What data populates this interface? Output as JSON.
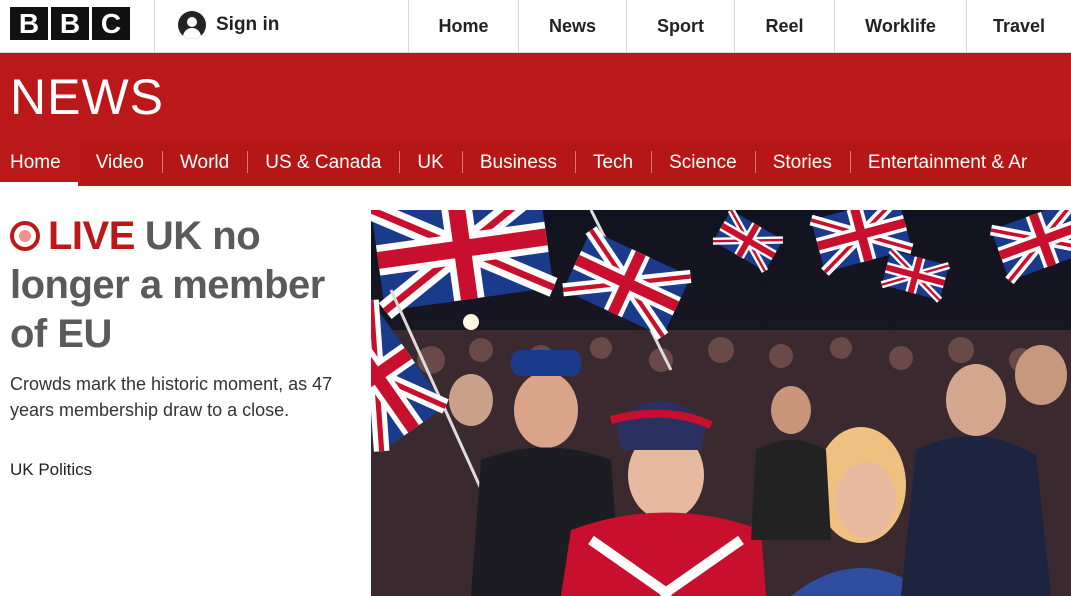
{
  "brand": {
    "letters": [
      "B",
      "B",
      "C"
    ]
  },
  "account": {
    "signin_label": "Sign in"
  },
  "top_nav": [
    "Home",
    "News",
    "Sport",
    "Reel",
    "Worklife",
    "Travel"
  ],
  "section": {
    "title": "NEWS"
  },
  "sub_nav": [
    "Home",
    "Video",
    "World",
    "US & Canada",
    "UK",
    "Business",
    "Tech",
    "Science",
    "Stories",
    "Entertainment & Ar"
  ],
  "article": {
    "live_label": "LIVE",
    "headline": "UK no longer a member of EU",
    "summary": "Crowds mark the historic moment, as 47 years membership draw to a close.",
    "tag": "UK Politics"
  },
  "colors": {
    "brand_red": "#bb1919",
    "live_red": "#bb1919",
    "black": "#111111"
  },
  "icons": {
    "signin": "user-icon",
    "live": "live-indicator-icon"
  }
}
